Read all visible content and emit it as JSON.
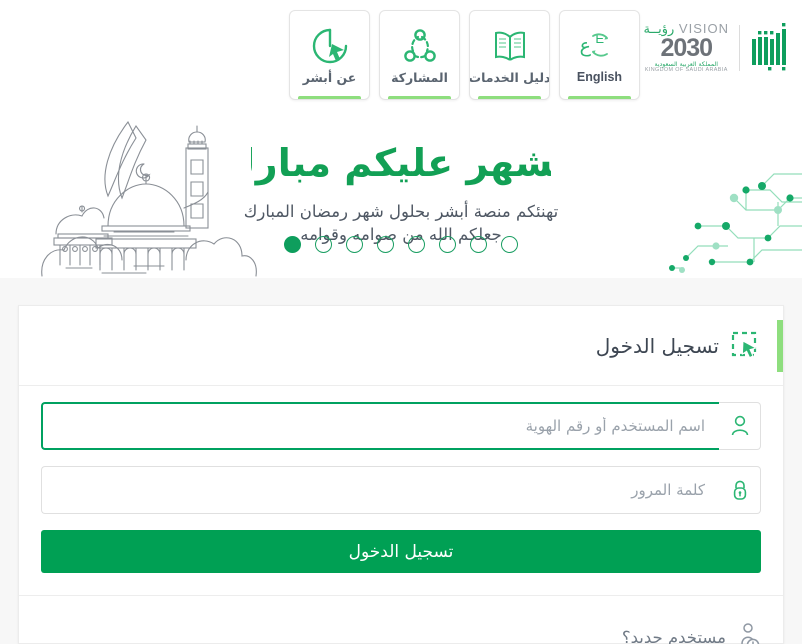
{
  "colors": {
    "brand_green": "#00a054",
    "accent_light_green": "#8ede7e",
    "dot_green": "#0e9e5d",
    "text_dark": "#3d4652",
    "text_muted": "#707a86",
    "page_bg": "#f7f7f7"
  },
  "nav": {
    "items": [
      {
        "label": "عن أبشر",
        "icon": "about-absher-icon"
      },
      {
        "label": "المشاركة",
        "icon": "share-network-icon"
      },
      {
        "label": "دليل الخدمات",
        "icon": "services-guide-book-icon"
      },
      {
        "label": "English",
        "icon": "language-toggle-icon"
      }
    ]
  },
  "logos": {
    "vision": {
      "word_en": "VISION",
      "word_ar": "رؤيــة",
      "year": "2030",
      "kingdom_ar": "المملكة العربية السعودية",
      "kingdom_en": "KINGDOM OF SAUDI ARABIA"
    },
    "absher": {
      "name": "absher-logo",
      "alt": "أبشر"
    }
  },
  "banner": {
    "calligraphy": "الشهر عليكم مبارك",
    "line1": "تهنئكم منصة أبشر بحلول شهر رمضان المبارك",
    "line2": "جعلكم الله من صوامه وقوامه",
    "illustration": "mosque-crescent-illustration",
    "decoration": "circuit-network-pattern",
    "carousel": {
      "total": 8,
      "active_index": 7
    }
  },
  "login": {
    "title": "تسجيل الدخول",
    "title_icon": "select-cursor-icon",
    "username": {
      "placeholder": "اسم المستخدم أو رقم الهوية",
      "value": "",
      "icon": "user-icon",
      "focused": true
    },
    "password": {
      "placeholder": "كلمة المرور",
      "value": "",
      "icon": "lock-icon",
      "focused": false
    },
    "submit_label": "تسجيل الدخول",
    "new_user_label": "مستخدم جديد؟",
    "new_user_icon": "add-user-icon"
  }
}
